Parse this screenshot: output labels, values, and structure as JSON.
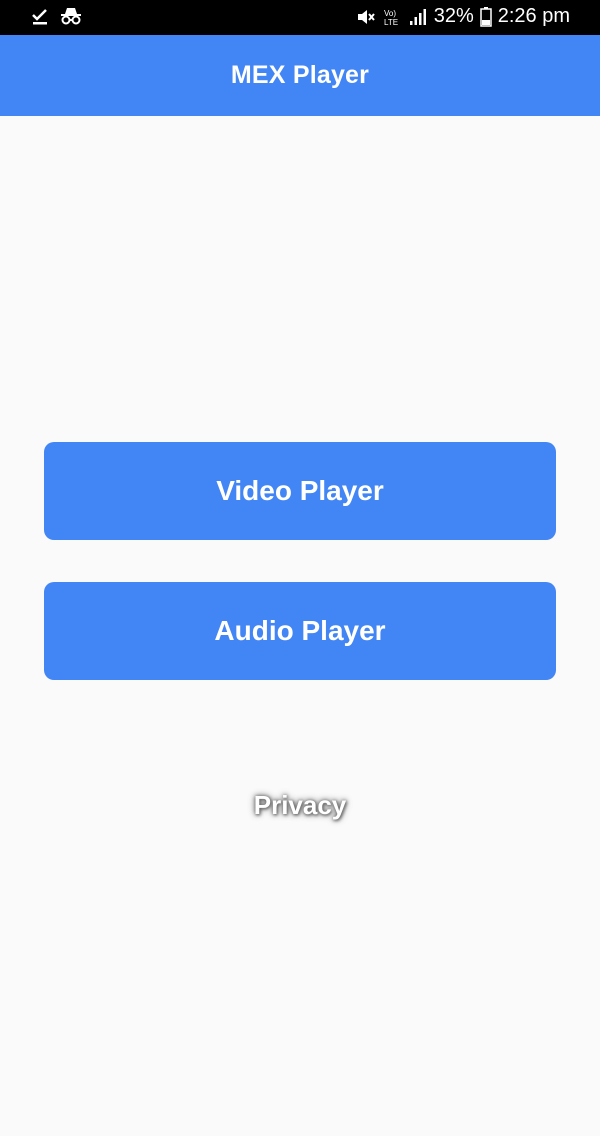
{
  "status_bar": {
    "battery_percent": "32%",
    "time": "2:26 pm",
    "network_label": "Vo) LTE",
    "icons": [
      "download-done-icon",
      "incognito-icon",
      "mute-icon",
      "volte-icon",
      "signal-icon",
      "battery-icon"
    ]
  },
  "app_bar": {
    "title": "MEX Player",
    "color": "#4285f4"
  },
  "main": {
    "video_button_label": "Video Player",
    "audio_button_label": "Audio Player",
    "privacy_label": "Privacy"
  }
}
